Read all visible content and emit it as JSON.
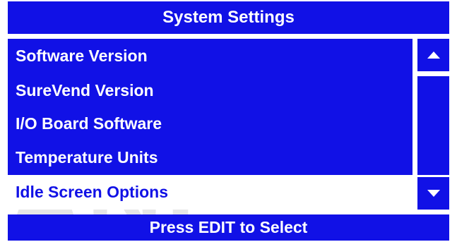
{
  "header": {
    "title": "System Settings"
  },
  "menu": {
    "items": [
      {
        "label": "Software Version",
        "selected": false
      },
      {
        "label": "SureVend Version",
        "selected": false
      },
      {
        "label": "I/O Board Software",
        "selected": false
      },
      {
        "label": "Temperature Units",
        "selected": false
      },
      {
        "label": "Idle Screen Options",
        "selected": true
      }
    ]
  },
  "scrollbar": {
    "up_icon": "triangle-up-icon",
    "down_icon": "triangle-down-icon"
  },
  "footer": {
    "hint": "Press EDIT to Select"
  },
  "colors": {
    "accent": "#1111e6",
    "text_on_accent": "#ffffff",
    "background": "#ffffff"
  }
}
